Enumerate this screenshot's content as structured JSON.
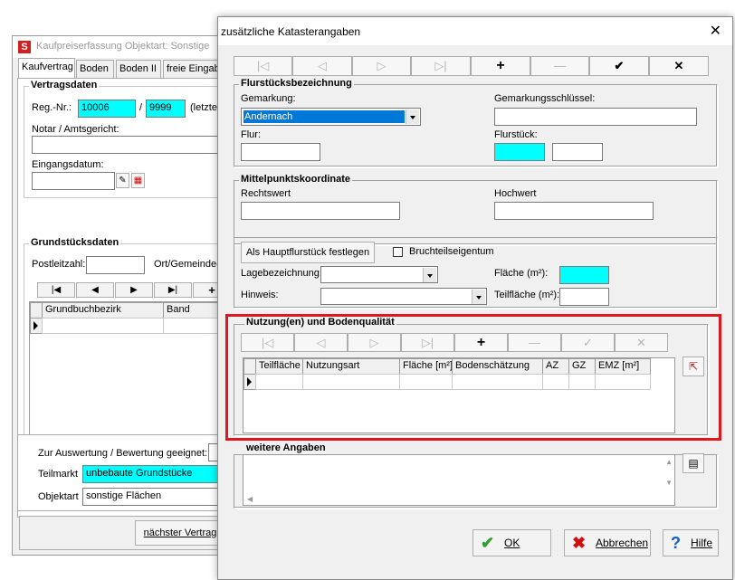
{
  "bg_window": {
    "title": "Kaufpreiserfassung  Objektart: Sonstige",
    "tabs": [
      "Kaufvertrag",
      "Boden",
      "Boden II",
      "freie Eingab"
    ],
    "vertragsdaten": {
      "group_label": "Vertragsdaten",
      "reg_nr_label": "Reg.-Nr.:",
      "reg_nr_value_1": "10006",
      "separator": "/",
      "reg_nr_value_2": "9999",
      "letzte_label": "(letzte R",
      "notar_label": "Notar / Amtsgericht:",
      "eingangsdatum_label": "Eingangsdatum:"
    },
    "grundstuecksdaten": {
      "group_label": "Grundstücksdaten",
      "postleitzahl_label": "Postleitzahl:",
      "ort_label": "Ort/Gemeinde(",
      "nav_buttons": [
        "|◀",
        "◀",
        "▶",
        "▶|",
        "+"
      ],
      "columns": [
        "Grundbuchbezirk",
        "Band"
      ]
    },
    "auswertung_label": "Zur Auswertung / Bewertung geeignet:",
    "teilmarkt_label": "Teilmarkt",
    "teilmarkt_value": "unbebaute Grundstücke",
    "objektart_label": "Objektart",
    "objektart_value": "sonstige Flächen",
    "naechster_vertrag_label": "nächster Vertrag"
  },
  "dialog": {
    "title": "zusätzliche Katasterangaben",
    "close_icon": "✕",
    "toolbar": [
      {
        "icon": "first-icon",
        "glyph": "|◁",
        "enabled": false
      },
      {
        "icon": "prev-icon",
        "glyph": "◁",
        "enabled": false
      },
      {
        "icon": "next-icon",
        "glyph": "▷",
        "enabled": false
      },
      {
        "icon": "last-icon",
        "glyph": "▷|",
        "enabled": false
      },
      {
        "icon": "add-icon",
        "glyph": "+",
        "enabled": true
      },
      {
        "icon": "remove-icon",
        "glyph": "—",
        "enabled": false
      },
      {
        "icon": "check-icon",
        "glyph": "✔",
        "enabled": true
      },
      {
        "icon": "cancel-icon",
        "glyph": "✕",
        "enabled": true
      }
    ],
    "flurstueck": {
      "group_label": "Flurstücksbezeichnung",
      "gemarkung_label": "Gemarkung:",
      "gemarkung_value": "Andernach",
      "gemarkungsschluessel_label": "Gemarkungsschlüssel:",
      "flur_label": "Flur:",
      "flurstueck_label": "Flurstück:"
    },
    "mittelpunkt": {
      "group_label": "Mittelpunktskoordinate",
      "rechtswert_label": "Rechtswert",
      "hochwert_label": "Hochwert"
    },
    "lage": {
      "hauptflurstueck_button": "Als Hauptflurstück festlegen",
      "bruchteil_label": "Bruchteilseigentum",
      "lagebezeichnung_label": "Lagebezeichnung:",
      "hinweis_label": "Hinweis:",
      "flaeche_label": "Fläche (m²):",
      "teilflaeche_label": "Teilfläche (m²):"
    },
    "nutzung": {
      "group_label": "Nutzung(en) und Bodenqualität",
      "toolbar": [
        {
          "icon": "first-icon",
          "glyph": "|◁",
          "enabled": false
        },
        {
          "icon": "prev-icon",
          "glyph": "◁",
          "enabled": false
        },
        {
          "icon": "next-icon",
          "glyph": "▷",
          "enabled": false
        },
        {
          "icon": "last-icon",
          "glyph": "▷|",
          "enabled": false
        },
        {
          "icon": "add-icon",
          "glyph": "+",
          "enabled": true
        },
        {
          "icon": "remove-icon",
          "glyph": "—",
          "enabled": false
        },
        {
          "icon": "confirm-icon",
          "glyph": "✓",
          "enabled": false
        },
        {
          "icon": "cancel-icon",
          "glyph": "✕",
          "enabled": false
        }
      ],
      "columns": [
        "Teilfläche",
        "Nutzungsart",
        "Fläche [m²]",
        "Bodenschätzung",
        "AZ",
        "GZ",
        "EMZ [m²]"
      ]
    },
    "weitere": {
      "group_label": "weitere Angaben"
    },
    "buttons": {
      "ok": "OK",
      "abbrechen": "Abbrechen",
      "hilfe": "Hilfe"
    },
    "colors": {
      "highlight": "#e0161e",
      "cyan_field": "#00ffff",
      "selection": "#0078d7"
    }
  }
}
